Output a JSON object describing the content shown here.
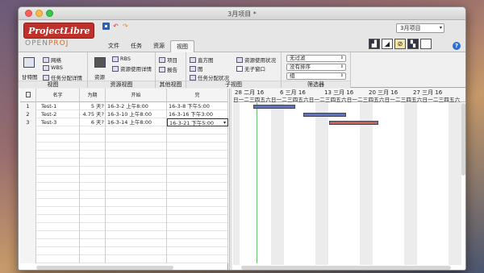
{
  "window": {
    "title": "3月项目 *"
  },
  "logo": {
    "brand": "ProjectLibre",
    "sub_open": "OPEN",
    "sub_proj": "PROJ"
  },
  "tabs": [
    {
      "label": "文件"
    },
    {
      "label": "任务"
    },
    {
      "label": "资源"
    },
    {
      "label": "视图"
    }
  ],
  "project_select": {
    "value": "3月项目"
  },
  "ribbon": {
    "views": {
      "group": "视图",
      "gantt": "甘特图",
      "network": "网络",
      "wbs": "WBS",
      "task_usage": "任务分配详情"
    },
    "resource_views": {
      "group": "资源视图",
      "resources": "资源",
      "rbs": "RBS",
      "resource_usage": "资源使用详情"
    },
    "other_views": {
      "group": "其他视图",
      "projects": "项目",
      "reports": "报告"
    },
    "sub_views": {
      "group": "子视图",
      "histogram": "直方图",
      "chart": "图",
      "task_usage": "任务分配状况",
      "resource_usage": "资源使用状况",
      "no_sub": "无子窗口"
    },
    "filters": {
      "group": "筛选器",
      "filter": "无过滤",
      "sort": "没有排序",
      "group_by": "组"
    }
  },
  "table": {
    "columns": [
      "名字",
      "为期",
      "开始",
      "完"
    ],
    "rows": [
      {
        "n": "1",
        "name": "Test-1",
        "dur": "5 天?",
        "start": "16-3-2 上午8:00",
        "finish": "16-3-8 下午5:00"
      },
      {
        "n": "2",
        "name": "Test-2",
        "dur": "4.75 天?",
        "start": "16-3-10 上午8:00",
        "finish": "16-3-16 下午3:00"
      },
      {
        "n": "3",
        "name": "Test-3",
        "dur": "6 天?",
        "start": "16-3-14 上午8:00",
        "finish": "16-3-21 下午5:00"
      }
    ]
  },
  "gantt": {
    "weeks": [
      "28 二月 16",
      "6 三月 16",
      "13 三月 16",
      "20 三月 16",
      "27 三月 16"
    ],
    "day_letters": "日一二三四五六",
    "bars": [
      {
        "task": "Test-1",
        "start": "16-3-2",
        "finish": "16-3-8",
        "color": "#5b73c6"
      },
      {
        "task": "Test-2",
        "start": "16-3-10",
        "finish": "16-3-16",
        "color": "#5b73c6"
      },
      {
        "task": "Test-3",
        "start": "16-3-14",
        "finish": "16-3-21",
        "color": "#d0624a"
      }
    ]
  },
  "colors": {
    "accent": "#c0302a",
    "bar_blue": "#5b73c6",
    "bar_red": "#d0624a"
  }
}
